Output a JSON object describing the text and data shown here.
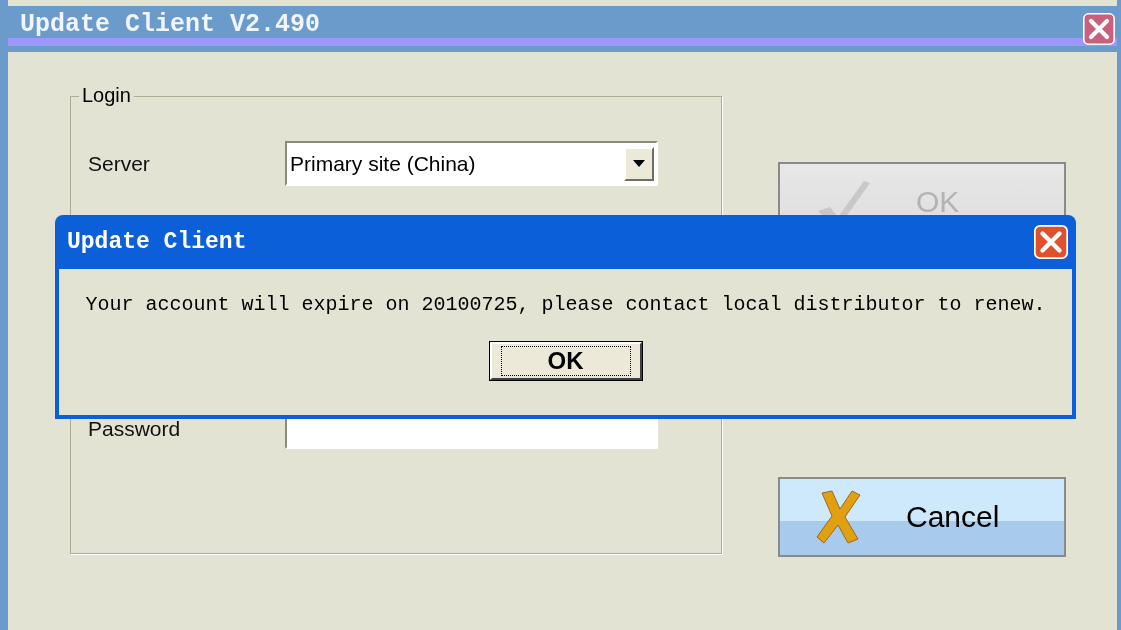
{
  "window": {
    "title": "Update Client V2.490"
  },
  "login": {
    "legend": "Login",
    "server_label": "Server",
    "server_value": "Primary site (China)",
    "password_label": "Password"
  },
  "buttons": [
    {
      "kind": "ok",
      "label": "OK",
      "disabled": true
    },
    {
      "kind": "cancel",
      "label": "Cancel",
      "disabled": false
    }
  ],
  "dialog": {
    "title": "Update Client",
    "message": "Your account will expire on 20100725, please contact local distributor to renew.",
    "button": "OK"
  }
}
